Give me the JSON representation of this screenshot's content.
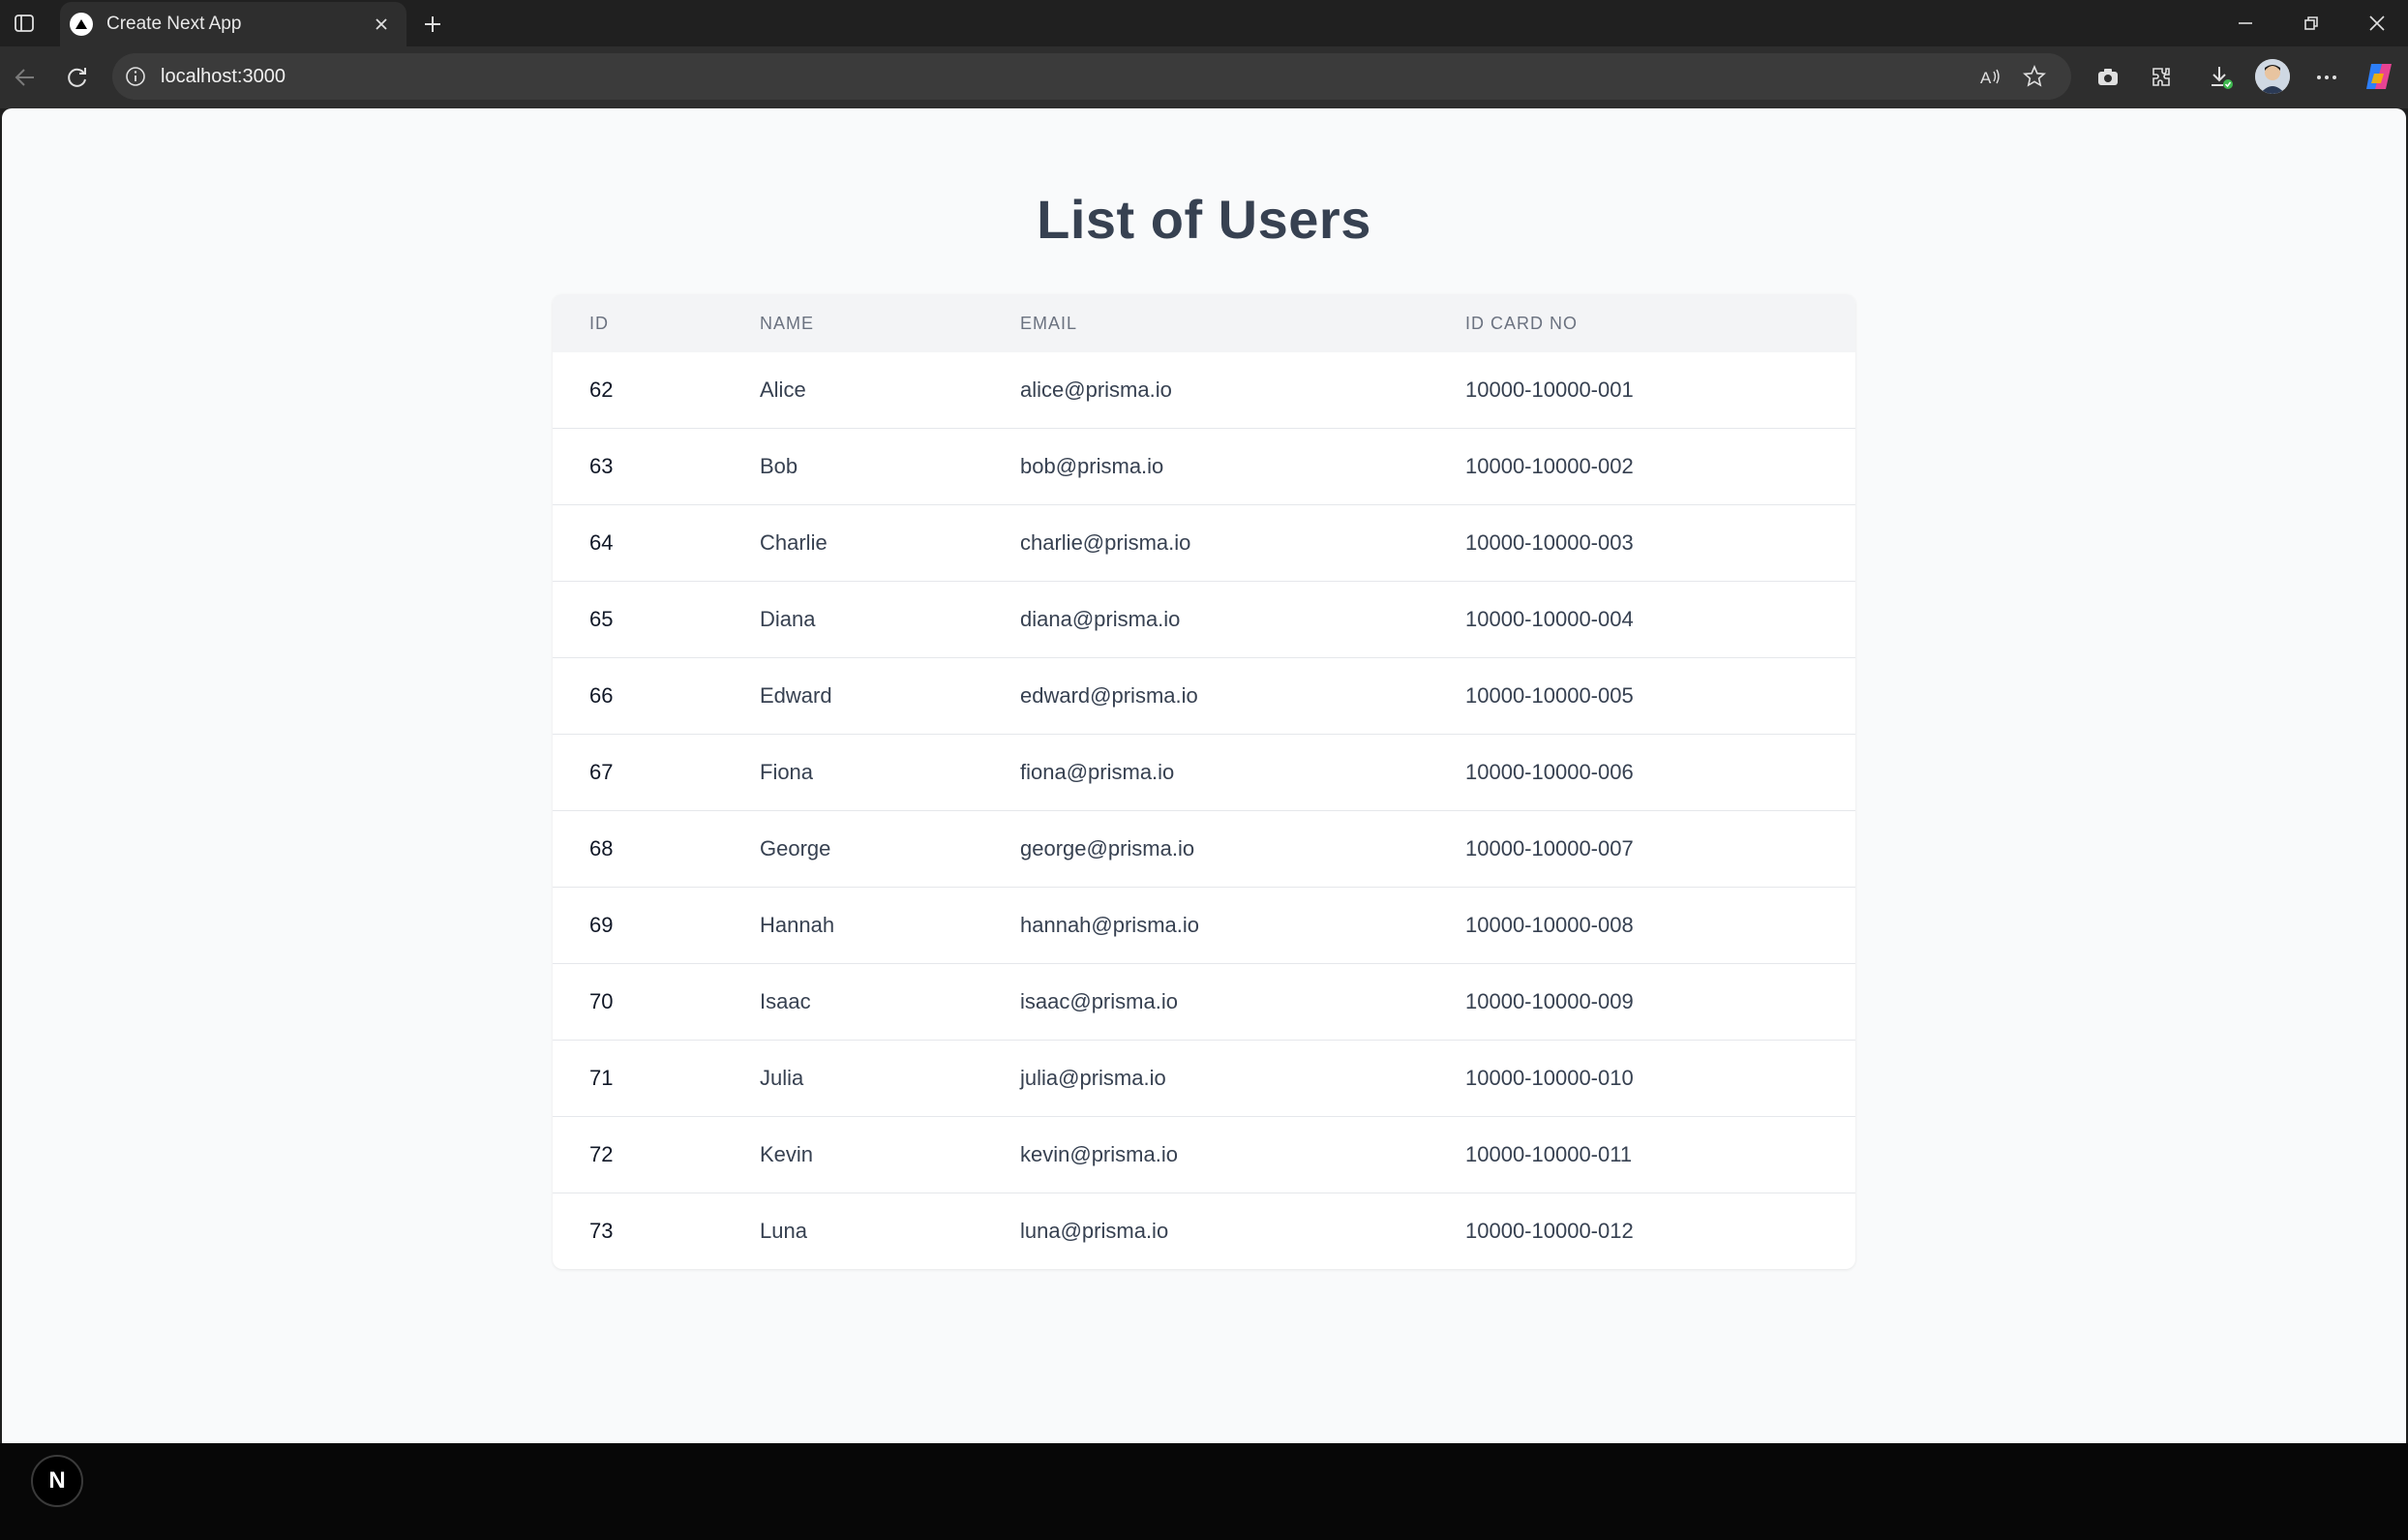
{
  "browser": {
    "tab_title": "Create Next App",
    "url": "localhost:3000"
  },
  "page": {
    "title": "List of Users",
    "columns": [
      "ID",
      "NAME",
      "EMAIL",
      "ID CARD NO"
    ],
    "rows": [
      {
        "id": "62",
        "name": "Alice",
        "email": "alice@prisma.io",
        "id_card": "10000-10000-001"
      },
      {
        "id": "63",
        "name": "Bob",
        "email": "bob@prisma.io",
        "id_card": "10000-10000-002"
      },
      {
        "id": "64",
        "name": "Charlie",
        "email": "charlie@prisma.io",
        "id_card": "10000-10000-003"
      },
      {
        "id": "65",
        "name": "Diana",
        "email": "diana@prisma.io",
        "id_card": "10000-10000-004"
      },
      {
        "id": "66",
        "name": "Edward",
        "email": "edward@prisma.io",
        "id_card": "10000-10000-005"
      },
      {
        "id": "67",
        "name": "Fiona",
        "email": "fiona@prisma.io",
        "id_card": "10000-10000-006"
      },
      {
        "id": "68",
        "name": "George",
        "email": "george@prisma.io",
        "id_card": "10000-10000-007"
      },
      {
        "id": "69",
        "name": "Hannah",
        "email": "hannah@prisma.io",
        "id_card": "10000-10000-008"
      },
      {
        "id": "70",
        "name": "Isaac",
        "email": "isaac@prisma.io",
        "id_card": "10000-10000-009"
      },
      {
        "id": "71",
        "name": "Julia",
        "email": "julia@prisma.io",
        "id_card": "10000-10000-010"
      },
      {
        "id": "72",
        "name": "Kevin",
        "email": "kevin@prisma.io",
        "id_card": "10000-10000-011"
      },
      {
        "id": "73",
        "name": "Luna",
        "email": "luna@prisma.io",
        "id_card": "10000-10000-012"
      }
    ]
  },
  "dev_indicator": {
    "label": "N"
  },
  "colors": {
    "page_bg": "#f9fafb",
    "title": "#374151",
    "header_bg": "#f3f4f6",
    "chrome_bg": "#202020"
  },
  "icons": [
    "tab-actions-icon",
    "nextjs-favicon-icon",
    "close-icon",
    "plus-icon",
    "minimize-icon",
    "restore-icon",
    "window-close-icon",
    "back-arrow-icon",
    "refresh-icon",
    "info-icon",
    "read-aloud-icon",
    "favorite-star-icon",
    "screenshot-icon",
    "extensions-icon",
    "downloads-icon",
    "more-icon",
    "copilot-icon"
  ]
}
